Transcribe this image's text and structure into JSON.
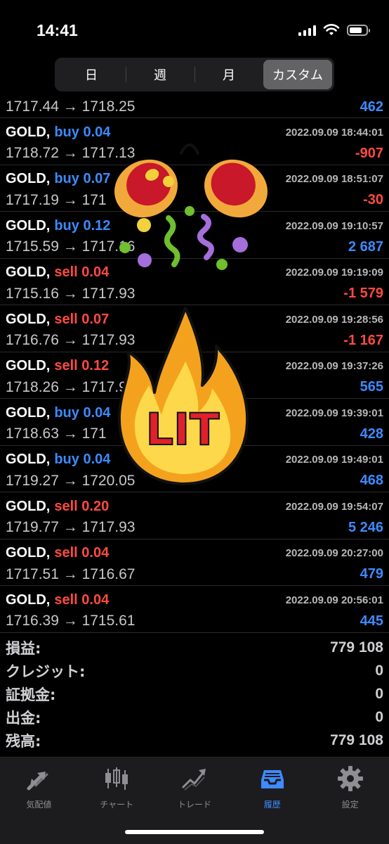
{
  "status_bar": {
    "time": "14:41",
    "icons": [
      "signal-icon",
      "wifi-icon",
      "battery-icon"
    ]
  },
  "segments": [
    {
      "label": "日",
      "active": false
    },
    {
      "label": "週",
      "active": false
    },
    {
      "label": "月",
      "active": false
    },
    {
      "label": "カスタム",
      "active": true
    }
  ],
  "partial_deal": {
    "prices": "1717.44 → 1718.25",
    "profit": "462"
  },
  "deals": [
    {
      "symbol": "GOLD,",
      "side": "buy",
      "volume": "buy 0.04",
      "datetime": "2022.09.09 18:44:01",
      "prices": "1718.72 → 1717.13",
      "profit": "-907"
    },
    {
      "symbol": "GOLD,",
      "side": "buy",
      "volume": "buy 0.07",
      "datetime": "2022.09.09 18:51:07",
      "prices": "1717.19 → 171",
      "profit": "-30"
    },
    {
      "symbol": "GOLD,",
      "side": "buy",
      "volume": "buy 0.12",
      "datetime": "2022.09.09 19:10:57",
      "prices": "1715.59 → 1717.16",
      "profit": "2 687"
    },
    {
      "symbol": "GOLD,",
      "side": "sell",
      "volume": "sell 0.04",
      "datetime": "2022.09.09 19:19:09",
      "prices": "1715.16 → 1717.93",
      "profit": "-1 579"
    },
    {
      "symbol": "GOLD,",
      "side": "sell",
      "volume": "sell 0.07",
      "datetime": "2022.09.09 19:28:56",
      "prices": "1716.76 → 1717.93",
      "profit": "-1 167"
    },
    {
      "symbol": "GOLD,",
      "side": "sell",
      "volume": "sell 0.12",
      "datetime": "2022.09.09 19:37:26",
      "prices": "1718.26 → 1717.93",
      "profit": "565"
    },
    {
      "symbol": "GOLD,",
      "side": "buy",
      "volume": "buy 0.04",
      "datetime": "2022.09.09 19:39:01",
      "prices": "1718.63 → 171",
      "profit": "428"
    },
    {
      "symbol": "GOLD,",
      "side": "buy",
      "volume": "buy 0.04",
      "datetime": "2022.09.09 19:49:01",
      "prices": "1719.27 → 1720.05",
      "profit": "468"
    },
    {
      "symbol": "GOLD,",
      "side": "sell",
      "volume": "sell 0.20",
      "datetime": "2022.09.09 19:54:07",
      "prices": "1719.77 → 1717.93",
      "profit": "5 246"
    },
    {
      "symbol": "GOLD,",
      "side": "sell",
      "volume": "sell 0.04",
      "datetime": "2022.09.09 20:27:00",
      "prices": "1717.51 → 1716.67",
      "profit": "479"
    },
    {
      "symbol": "GOLD,",
      "side": "sell",
      "volume": "sell 0.04",
      "datetime": "2022.09.09 20:56:01",
      "prices": "1716.39 → 1715.61",
      "profit": "445"
    }
  ],
  "summary": [
    {
      "label": "損益:",
      "value": "779 108"
    },
    {
      "label": "クレジット:",
      "value": "0"
    },
    {
      "label": "証拠金:",
      "value": "0"
    },
    {
      "label": "出金:",
      "value": "0"
    },
    {
      "label": "残高:",
      "value": "779 108"
    }
  ],
  "tabs": [
    {
      "label": "気配値",
      "icon": "quotes-arrows-icon",
      "active": false
    },
    {
      "label": "チャート",
      "icon": "candlestick-chart-icon",
      "active": false
    },
    {
      "label": "トレード",
      "icon": "trade-line-icon",
      "active": false
    },
    {
      "label": "履歴",
      "icon": "history-tray-icon",
      "active": true
    },
    {
      "label": "設定",
      "icon": "settings-gear-icon",
      "active": false
    }
  ],
  "stickers": {
    "party": "party-popper-sticker",
    "lit": "LIT"
  },
  "colors": {
    "buy": "#3d8bff",
    "sell": "#ff4a42",
    "background": "#000000",
    "tabbar": "#1c1c1e",
    "accent": "#3d8bff"
  }
}
